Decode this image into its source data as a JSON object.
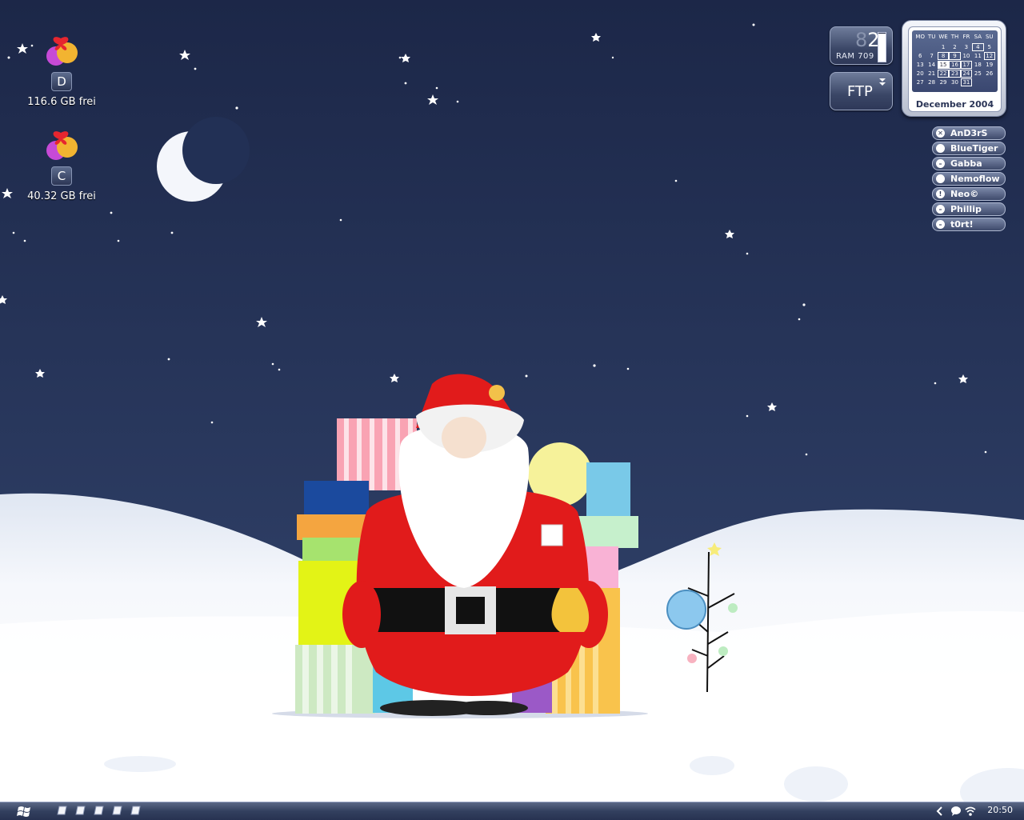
{
  "desktop": {
    "drives": [
      {
        "letter": "D",
        "free": "116.6 GB frei",
        "icon": "gift-drive-icon"
      },
      {
        "letter": "C",
        "free": "40.32 GB frei",
        "icon": "gift-drive-icon"
      }
    ]
  },
  "ram_widget": {
    "cpu_dim": "8",
    "cpu_bright": "2",
    "ram_label": "RAM 709",
    "bar_level": 0.97
  },
  "ftp_widget": {
    "label": "FTP",
    "icon": "chevron-down-icon"
  },
  "calendar": {
    "weekday_headers": [
      "MO",
      "TU",
      "WE",
      "TH",
      "FR",
      "SA",
      "SU"
    ],
    "weeks": [
      [
        "",
        "",
        "1",
        "2",
        "3",
        "4",
        "5"
      ],
      [
        "6",
        "7",
        "8",
        "9",
        "10",
        "11",
        "12"
      ],
      [
        "13",
        "14",
        "15",
        "16",
        "17",
        "18",
        "19"
      ],
      [
        "20",
        "21",
        "22",
        "23",
        "24",
        "25",
        "26"
      ],
      [
        "27",
        "28",
        "29",
        "30",
        "31",
        "",
        ""
      ]
    ],
    "marked_days": [
      "4",
      "8",
      "9",
      "12",
      "15",
      "16",
      "17",
      "22",
      "23",
      "24",
      "31"
    ],
    "today": "15",
    "month_label": "December 2004"
  },
  "buddies": [
    {
      "name": "AnD3rS",
      "status": "away",
      "glyph": "✕"
    },
    {
      "name": "BlueTiger",
      "status": "online",
      "glyph": ""
    },
    {
      "name": "Gabba",
      "status": "busy",
      "glyph": "–"
    },
    {
      "name": "Nemoflow",
      "status": "online",
      "glyph": ""
    },
    {
      "name": "Neo©",
      "status": "alert",
      "glyph": "!"
    },
    {
      "name": "Phillip",
      "status": "busy",
      "glyph": "–"
    },
    {
      "name": "t0rt!",
      "status": "busy",
      "glyph": "–"
    }
  ],
  "taskbar": {
    "start_icon": "windows-logo-icon",
    "quick_launch": [
      "quick-launch-icon",
      "quick-launch-icon",
      "quick-launch-icon",
      "quick-launch-icon",
      "quick-launch-icon"
    ],
    "tray_icons": [
      "tray-expand-icon",
      "messenger-icon",
      "wireless-icon"
    ],
    "clock": "20:50"
  },
  "colors": {
    "sky_top": "#1c2748",
    "sky_bottom": "#34466f",
    "snow": "#f2f5fb",
    "widget": "#3a4666"
  }
}
